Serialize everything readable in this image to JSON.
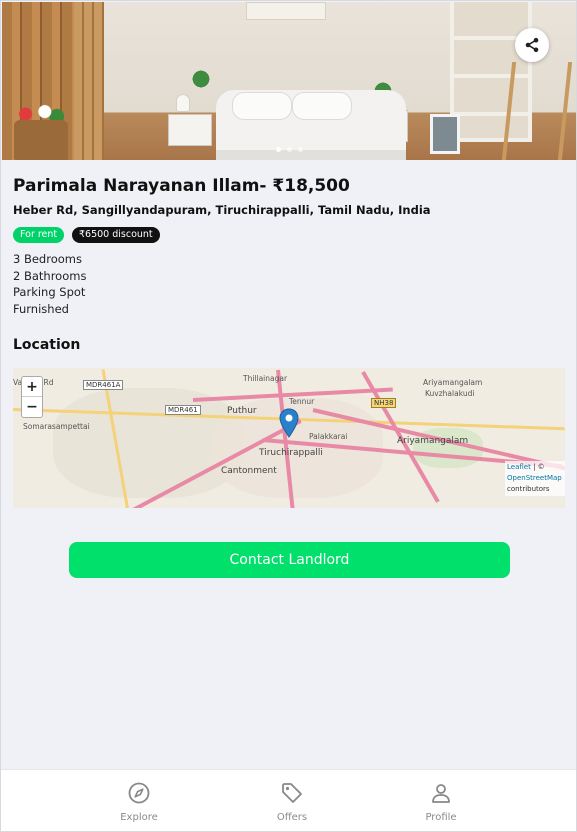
{
  "listing": {
    "title": "Parimala Narayanan Illam- ₹18,500",
    "address": "Heber Rd, Sangillyandapuram, Tiruchirappalli, Tamil Nadu, India",
    "badges": {
      "rent": "For rent",
      "discount": "₹6500 discount"
    },
    "features": [
      "3 Bedrooms",
      "2 Bathrooms",
      "Parking Spot",
      "Furnished"
    ],
    "photo_count": 3,
    "active_photo": 0,
    "share_icon": "share-icon"
  },
  "location": {
    "title": "Location",
    "zoom_in": "+",
    "zoom_out": "−",
    "map_labels": {
      "thillainagar": "Thillainagar",
      "ariyamangalam_n": "Ariyamangalam",
      "kuvzhalakudi": "Kuvzhalakudi",
      "somarasampettai": "Somarasampettai",
      "puthur": "Puthur",
      "tennur": "Tennur",
      "palakkarai": "Palakkarai",
      "ariyamangalam": "Ariyamangalam",
      "tiruchirappalli": "Tiruchirappalli",
      "cantonment": "Cantonment",
      "vayalur": "Vayalur Rd"
    },
    "shields": {
      "mdr461a": "MDR461A",
      "mdr461": "MDR461",
      "nh38": "NH38"
    },
    "attribution": {
      "leaflet": "Leaflet",
      "sep": " | © ",
      "osm": "OpenStreetMap",
      "contrib": " contributors"
    }
  },
  "actions": {
    "contact": "Contact Landlord"
  },
  "nav": {
    "items": [
      {
        "label": "Explore",
        "icon": "compass-icon"
      },
      {
        "label": "Offers",
        "icon": "tag-icon"
      },
      {
        "label": "Profile",
        "icon": "user-icon"
      }
    ]
  },
  "colors": {
    "accent": "#00e06b",
    "rent_badge": "#00d26a",
    "page_bg": "#f0f1f7",
    "marker": "#2a81cb"
  }
}
